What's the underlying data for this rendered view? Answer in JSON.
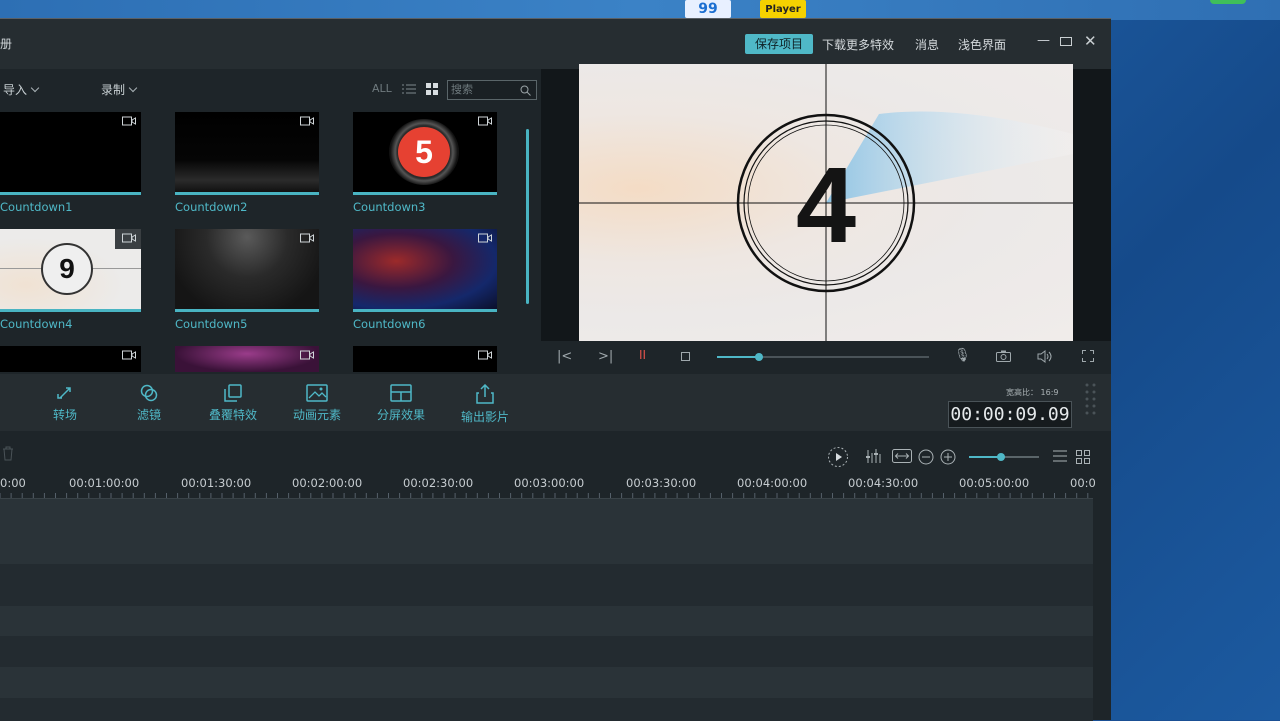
{
  "app": {
    "title": "册",
    "header_buttons": {
      "save": "保存项目",
      "more_effects": "下载更多特效",
      "messages": "消息",
      "light_theme": "浅色界面"
    }
  },
  "desktop": {
    "icons": [
      {
        "label": "Player"
      }
    ]
  },
  "media": {
    "import_label": "导入",
    "record_label": "录制",
    "all_label": "ALL",
    "search_placeholder": "搜索",
    "items": [
      {
        "label": "Countdown1"
      },
      {
        "label": "Countdown2"
      },
      {
        "label": "Countdown3",
        "badge": "5"
      },
      {
        "label": "Countdown4",
        "badge": "9"
      },
      {
        "label": "Countdown5"
      },
      {
        "label": "Countdown6"
      }
    ]
  },
  "preview": {
    "number": "4",
    "progress": 0.2
  },
  "effects": [
    {
      "label": "转场",
      "icon": "transition-icon"
    },
    {
      "label": "滤镜",
      "icon": "filter-icon"
    },
    {
      "label": "叠覆特效",
      "icon": "overlay-icon"
    },
    {
      "label": "动画元素",
      "icon": "element-icon"
    },
    {
      "label": "分屏效果",
      "icon": "split-screen-icon"
    },
    {
      "label": "输出影片",
      "icon": "export-icon"
    }
  ],
  "aspect_ratio": {
    "label": "宽高比：",
    "value": "16:9"
  },
  "timecode": "00:00:09.09",
  "ruler_labels": [
    "0:00",
    "00:01:00:00",
    "00:01:30:00",
    "00:02:00:00",
    "00:02:30:00",
    "00:03:00:00",
    "00:03:30:00",
    "00:04:00:00",
    "00:04:30:00",
    "00:05:00:00",
    "00:0"
  ],
  "colors": {
    "accent": "#4fb8c7",
    "background": "#1e2529",
    "panel": "#262d31"
  }
}
